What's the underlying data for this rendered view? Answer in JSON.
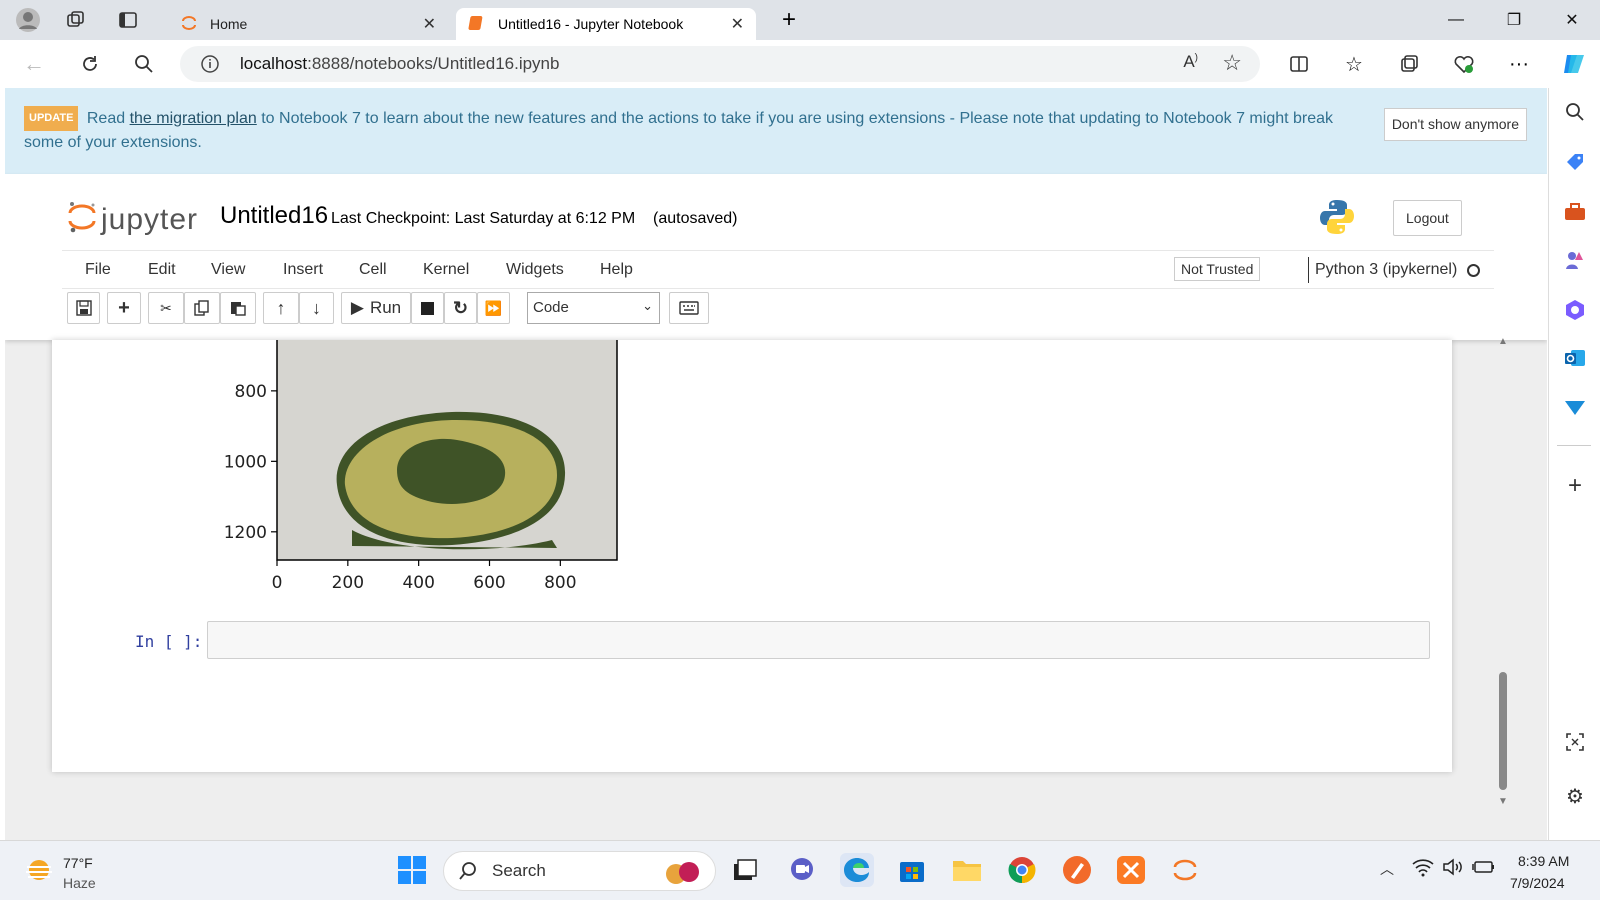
{
  "browser": {
    "tabs": [
      {
        "label": "Home",
        "active": false
      },
      {
        "label": "Untitled16 - Jupyter Notebook",
        "active": true
      }
    ],
    "url_host": "localhost",
    "url_path": ":8888/notebooks/Untitled16.ipynb"
  },
  "banner": {
    "badge": "UPDATE",
    "text_before": "Read",
    "link": "the migration plan",
    "text_after": "to Notebook 7 to learn about the new features and the actions to take if you are using extensions - Please note that updating to Notebook 7 might break some of your extensions.",
    "dismiss_label": "Don't show anymore"
  },
  "jupyter": {
    "logo_text": "jupyter",
    "notebook_name": "Untitled16",
    "checkpoint": "Last Checkpoint: Last Saturday at 6:12 PM",
    "autosave": "(autosaved)",
    "logout_label": "Logout",
    "menu": [
      "File",
      "Edit",
      "View",
      "Insert",
      "Cell",
      "Kernel",
      "Widgets",
      "Help"
    ],
    "trust_label": "Not Trusted",
    "kernel_name": "Python 3 (ipykernel)",
    "run_label": "Run",
    "cell_type": "Code",
    "prompt": "In [ ]:"
  },
  "chart_data": {
    "type": "image",
    "xticks": [
      "0",
      "200",
      "400",
      "600",
      "800"
    ],
    "yticks": [
      "800",
      "1000",
      "1200"
    ],
    "xlim": [
      0,
      960
    ],
    "ylim": [
      1280,
      650
    ]
  },
  "taskbar": {
    "temperature": "77°F",
    "condition": "Haze",
    "search_placeholder": "Search",
    "time": "8:39 AM",
    "date": "7/9/2024"
  }
}
